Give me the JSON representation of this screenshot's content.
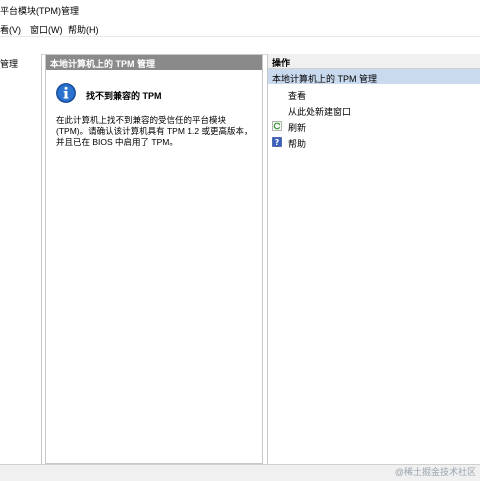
{
  "window": {
    "title": "平台模块(TPM)管理"
  },
  "menu": {
    "items": [
      "看(V)",
      "窗口(W)",
      "帮助(H)"
    ]
  },
  "tree": {
    "items": [
      {
        "label": "管理"
      }
    ]
  },
  "center": {
    "header": "本地计算机上的 TPM 管理",
    "message_title": "找不到兼容的 TPM",
    "message_body": "在此计算机上找不到兼容的受信任的平台模块(TPM)。请确认该计算机具有 TPM 1.2 或更高版本，并且已在 BIOS 中启用了 TPM。"
  },
  "actions": {
    "header": "操作",
    "subheader": "本地计算机上的 TPM 管理",
    "items": [
      {
        "label": "查看",
        "icon": "none"
      },
      {
        "label": "从此处新建窗口",
        "icon": "none"
      },
      {
        "label": "刷新",
        "icon": "refresh-icon"
      },
      {
        "label": "帮助",
        "icon": "help-icon"
      }
    ]
  },
  "watermark": "@稀土掘金技术社区",
  "colors": {
    "center_header_bg": "#8a8a8a",
    "actions_subheader_bg": "#c9d9ee",
    "info_icon_blue": "#1f5fb8"
  }
}
